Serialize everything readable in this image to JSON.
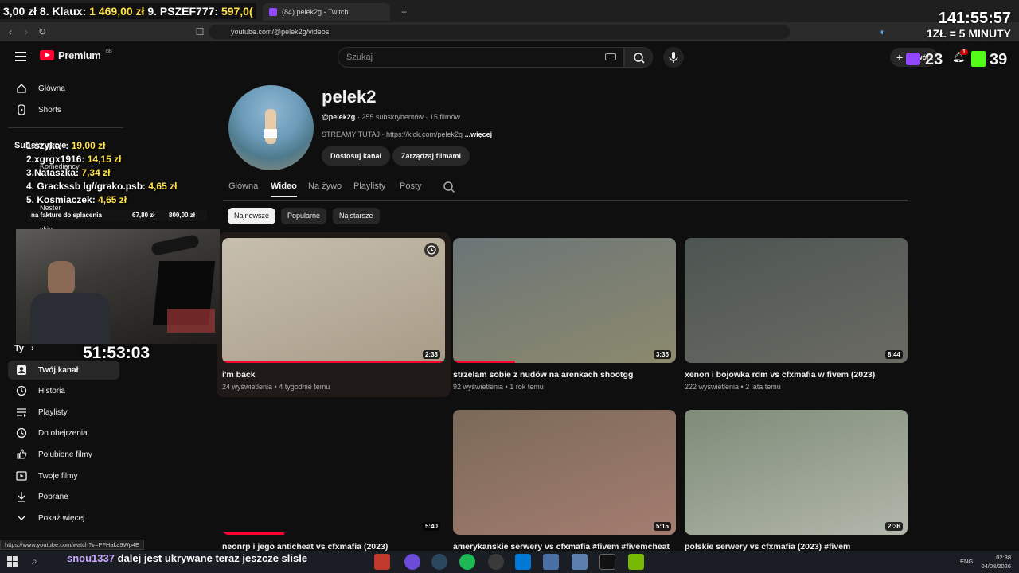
{
  "browser": {
    "tabs": [
      {
        "title": "(84) pelek2g - Twitch"
      }
    ],
    "url": "youtube.com/@pelek2g/videos",
    "status_url": "https://www.youtube.com/watch?v=PFHaka9Wp4E"
  },
  "overlay": {
    "ticker": {
      "prefix": "3,00 zł",
      "parts": [
        {
          "name": "8. Klaux:",
          "amount": "1 469,00 zł"
        },
        {
          "name": "9. PSZEF777:",
          "amount": "597,0("
        }
      ]
    },
    "big_timer": "141:55:57",
    "minuty": "1ZŁ = 5 MINUTY",
    "stream_timer": "51:53:03",
    "donors": [
      {
        "name": "1.szyka_:",
        "amount": "19,00 zł"
      },
      {
        "name": "2.xgrgx1916:",
        "amount": "14,15 zł"
      },
      {
        "name": "3.Nataszka:",
        "amount": "7,34 zł"
      },
      {
        "name": "4. Grackssb  lg//grako.psb:",
        "amount": "4,65 zł"
      },
      {
        "name": "5. Kosmiaczek:",
        "amount": "4,65 zł"
      }
    ],
    "goal": {
      "label": "na fakture do splacenia",
      "current": "67,80 zł",
      "target": "800,00 zł",
      "progress": 0.085
    },
    "chat": {
      "user": "snou1337",
      "message": "dalej jest ukrywane teraz jeszcze slisle"
    },
    "counters": {
      "viewers": "23",
      "kick": "39"
    }
  },
  "youtube": {
    "brand": "Premium",
    "region": "GB",
    "search_placeholder": "Szukaj",
    "create_label": "Utwórz",
    "notif_count": "1",
    "sidebar": {
      "top": [
        {
          "label": "Główna",
          "icon": "home-icon"
        },
        {
          "label": "Shorts",
          "icon": "shorts-icon"
        }
      ],
      "subs_heading": "Subskrypcje",
      "subs": [
        {
          "label": "Komediancy"
        },
        {
          "label": "Nester"
        },
        {
          "label": "vkio"
        }
      ],
      "you_heading": "Ty",
      "you": [
        {
          "label": "Twój kanał",
          "icon": "user-icon"
        },
        {
          "label": "Historia",
          "icon": "history-icon"
        },
        {
          "label": "Playlisty",
          "icon": "playlist-icon"
        },
        {
          "label": "Do obejrzenia",
          "icon": "clock-icon"
        },
        {
          "label": "Polubione filmy",
          "icon": "thumb-icon"
        },
        {
          "label": "Twoje filmy",
          "icon": "video-icon"
        },
        {
          "label": "Pobrane",
          "icon": "download-icon"
        },
        {
          "label": "Pokaż więcej",
          "icon": "chevron-down-icon"
        }
      ]
    },
    "channel": {
      "name": "pelek2",
      "handle": "@pelek2g",
      "subs": "255 subskrybentów",
      "videos": "15 filmów",
      "desc": "STREAMY TUTAJ · https://kick.com/pelek2g",
      "more": "...więcej",
      "btn_customize": "Dostosuj kanał",
      "btn_manage": "Zarządzaj filmami",
      "tabs": [
        "Główna",
        "Wideo",
        "Na żywo",
        "Playlisty",
        "Posty"
      ],
      "active_tab": "Wideo",
      "chips": [
        "Najnowsze",
        "Popularne",
        "Najstarsze"
      ]
    },
    "videos": [
      {
        "title": "i'm back",
        "views": "24 wyświetlenia",
        "age": "4 tygodnie temu",
        "duration": "2:33",
        "colors": [
          "#c7bfae",
          "#a89c88"
        ],
        "progress": 1.0
      },
      {
        "title": "strzelam sobie z nudów na arenkach shootgg",
        "views": "92 wyświetlenia",
        "age": "1 rok temu",
        "duration": "3:35",
        "colors": [
          "#6b7576",
          "#8c8a6e"
        ],
        "progress": 0.28
      },
      {
        "title": "xenon i bojowka rdm vs cfxmafia w fivem (2023)",
        "views": "222 wyświetlenia",
        "age": "2 lata temu",
        "duration": "8:44",
        "colors": [
          "#4d5552",
          "#6a6b63"
        ],
        "progress": 0.0
      },
      {
        "title": "neonrp i jego anticheat vs cfxmafia (2023)",
        "views": "",
        "age": "",
        "duration": "5:40",
        "colors": [
          "#0f0f0f",
          "#0f0f0f"
        ],
        "progress": 0.28
      },
      {
        "title": "amerykanskie serwery vs cfxmafia #fivem #fivemcheat",
        "views": "",
        "age": "",
        "duration": "5:15",
        "colors": [
          "#7a6a58",
          "#a47c70"
        ],
        "progress": 0.0
      },
      {
        "title": "polskie serwery vs cfxmafia (2023) #fivem",
        "views": "",
        "age": "",
        "duration": "2:36",
        "colors": [
          "#7e8b78",
          "#b2b7ab"
        ],
        "progress": 0.0
      }
    ]
  },
  "taskbar": {
    "lang": "ENG",
    "time": "02:38",
    "date": "04/08/2026"
  }
}
